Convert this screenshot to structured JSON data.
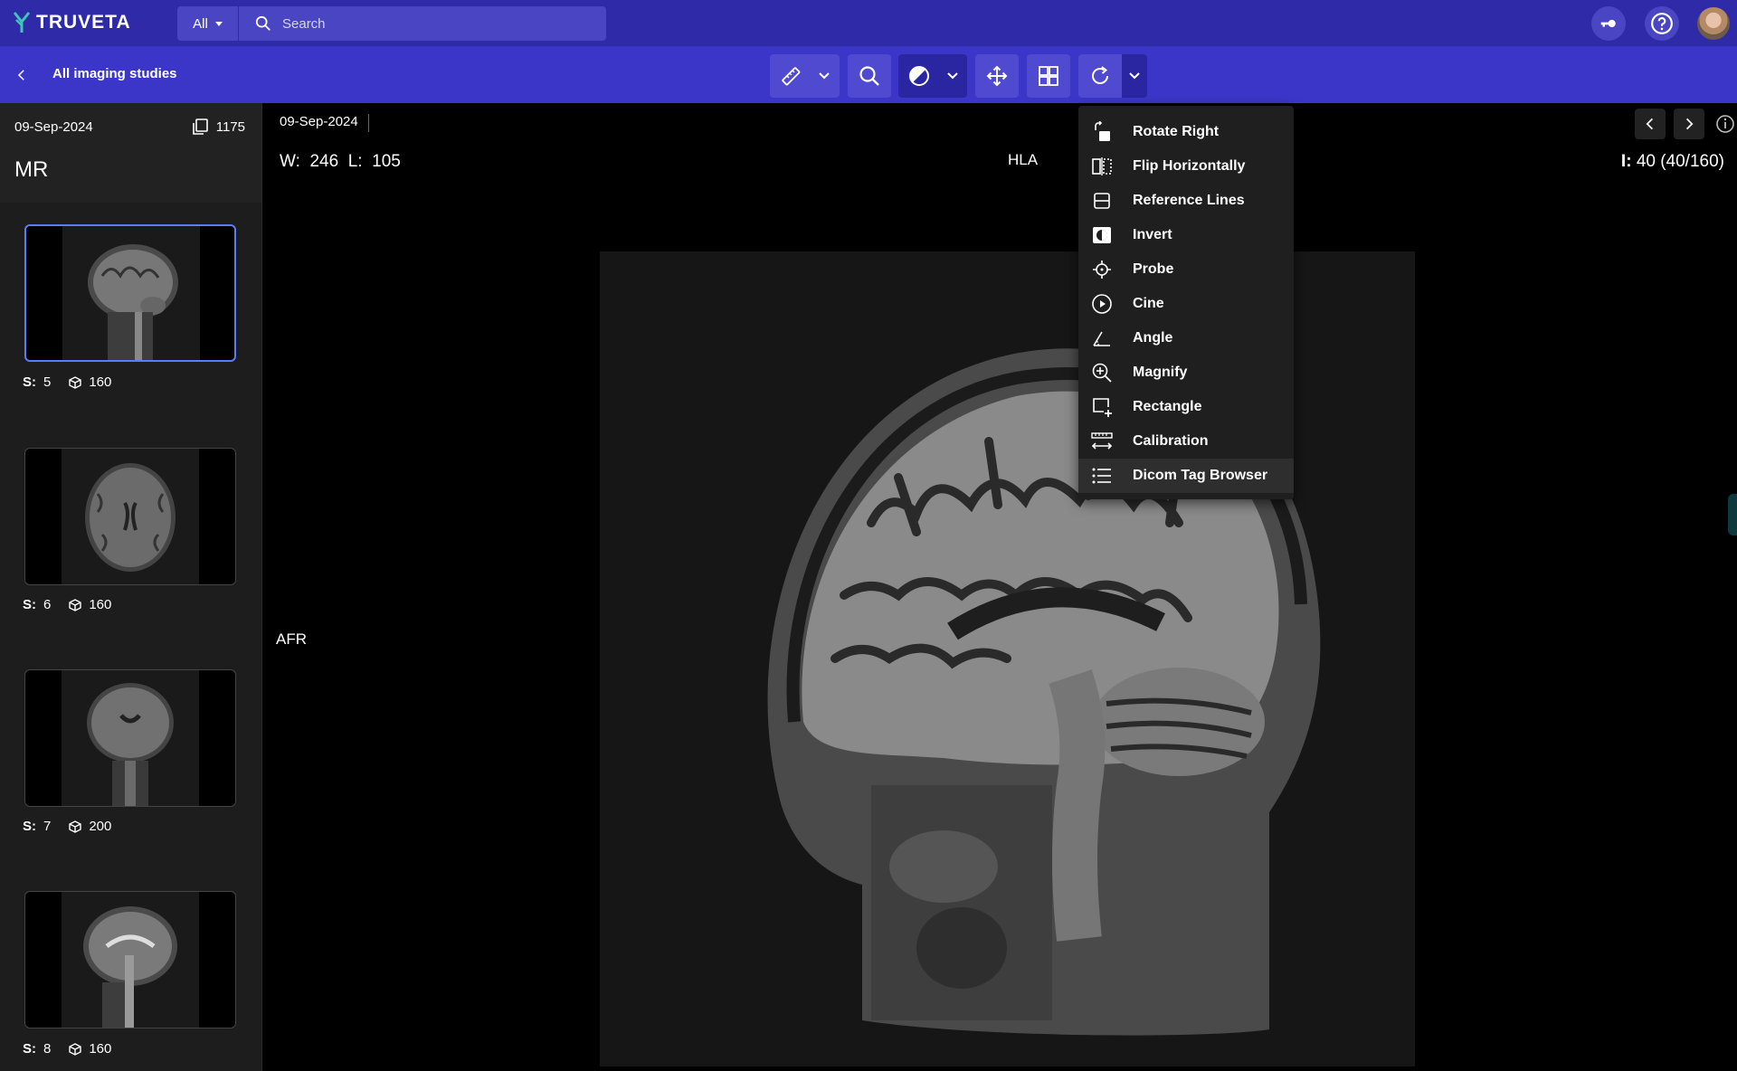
{
  "app": {
    "brand": "TRUVETA"
  },
  "search": {
    "scope": "All",
    "placeholder": "Search"
  },
  "subbar": {
    "back_label": "All imaging studies"
  },
  "sidebar": {
    "date": "09-Sep-2024",
    "count": "1175",
    "modality": "MR",
    "series": [
      {
        "label": "S:",
        "number": "5",
        "count": "160"
      },
      {
        "label": "S:",
        "number": "6",
        "count": "160"
      },
      {
        "label": "S:",
        "number": "7",
        "count": "200"
      },
      {
        "label": "S:",
        "number": "8",
        "count": "160"
      }
    ]
  },
  "viewer": {
    "date": "09-Sep-2024",
    "window_label": "W:",
    "window_value": "246",
    "level_label": "L:",
    "level_value": "105",
    "orient_top": "HLA",
    "orient_left": "AFR",
    "instance_label": "I:",
    "instance_value": "40 (40/160)"
  },
  "menu": {
    "items": [
      {
        "label": "Rotate Right",
        "icon": "rotate-right-icon"
      },
      {
        "label": "Flip Horizontally",
        "icon": "flip-horizontal-icon"
      },
      {
        "label": "Reference Lines",
        "icon": "reference-lines-icon"
      },
      {
        "label": "Invert",
        "icon": "invert-icon"
      },
      {
        "label": "Probe",
        "icon": "probe-icon"
      },
      {
        "label": "Cine",
        "icon": "cine-icon"
      },
      {
        "label": "Angle",
        "icon": "angle-icon"
      },
      {
        "label": "Magnify",
        "icon": "magnify-icon"
      },
      {
        "label": "Rectangle",
        "icon": "rectangle-icon"
      },
      {
        "label": "Calibration",
        "icon": "calibration-icon"
      },
      {
        "label": "Dicom Tag Browser",
        "icon": "list-icon"
      }
    ]
  },
  "colors": {
    "topbar": "#2f2aa8",
    "subbar": "#3b36c8",
    "accent": "#5b7cfa",
    "brand_teal": "#3fc5b4"
  }
}
